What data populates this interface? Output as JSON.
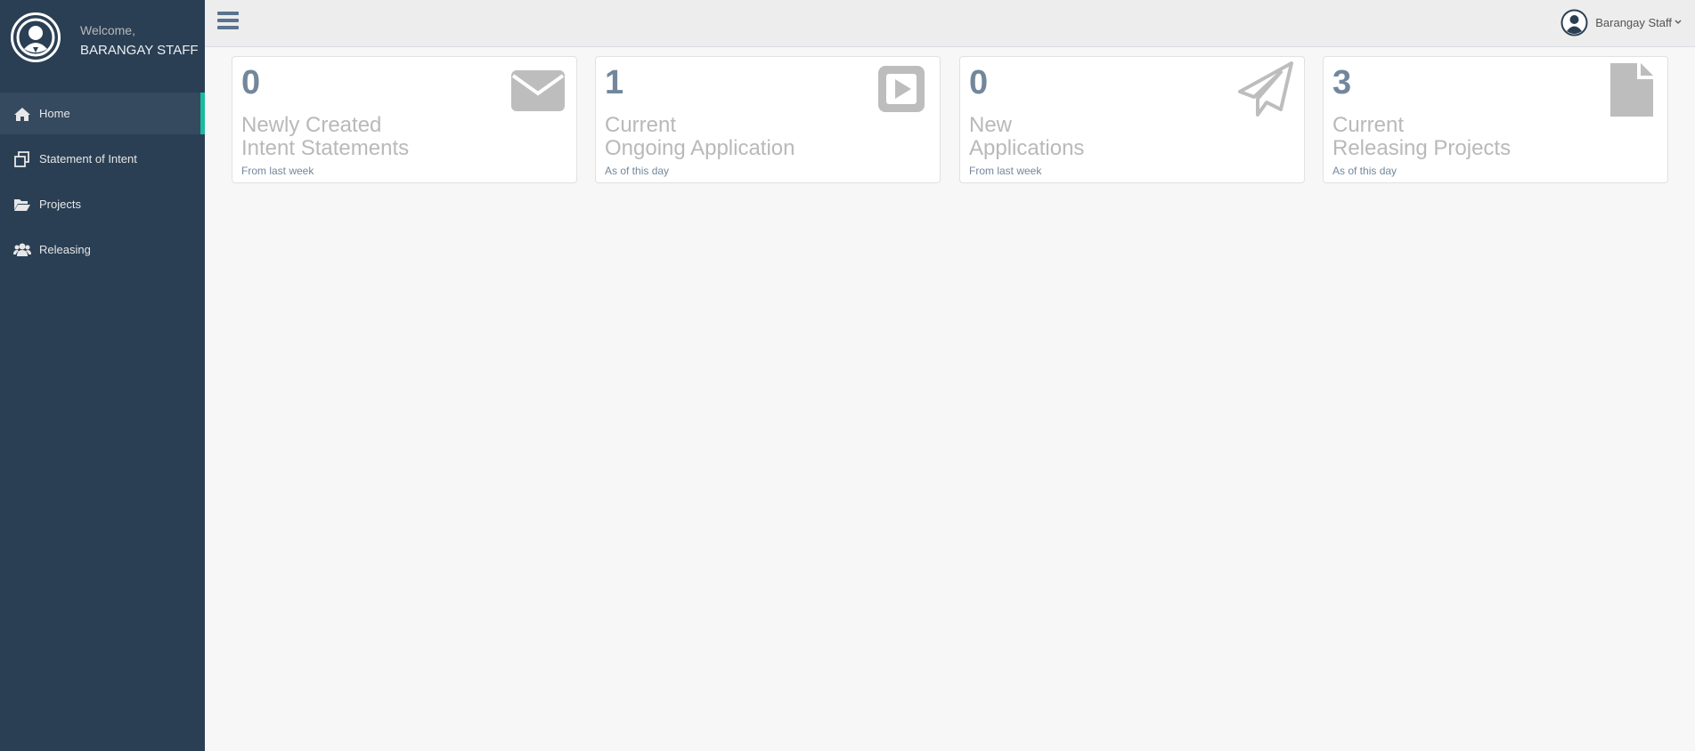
{
  "sidebar": {
    "welcome": "Welcome,",
    "user_name": "BARANGAY STAFF",
    "items": [
      {
        "label": "Home",
        "icon": "home-icon",
        "active": true
      },
      {
        "label": "Statement of Intent",
        "icon": "clone-icon"
      },
      {
        "label": "Projects",
        "icon": "folder-open-icon"
      },
      {
        "label": "Releasing",
        "icon": "users-icon"
      }
    ]
  },
  "topbar": {
    "user_label": "Barangay Staff",
    "menu_icon": "bars-icon"
  },
  "tiles": [
    {
      "count": "0",
      "title_line1": "Newly Created",
      "title_line2": "Intent Statements",
      "sub": "From last week",
      "icon": "envelope-icon"
    },
    {
      "count": "1",
      "title_line1": "Current",
      "title_line2": "Ongoing Application",
      "sub": "As of this day",
      "icon": "play-square-icon"
    },
    {
      "count": "0",
      "title_line1": "New",
      "title_line2": "Applications",
      "sub": "From last week",
      "icon": "paper-plane-icon"
    },
    {
      "count": "3",
      "title_line1": "Current",
      "title_line2": "Releasing Projects",
      "sub": "As of this day",
      "icon": "file-icon"
    }
  ],
  "colors": {
    "sidebar": "#2a3f54",
    "active_accent": "#1abb9c",
    "tile_icon": "#bdbdbd"
  }
}
